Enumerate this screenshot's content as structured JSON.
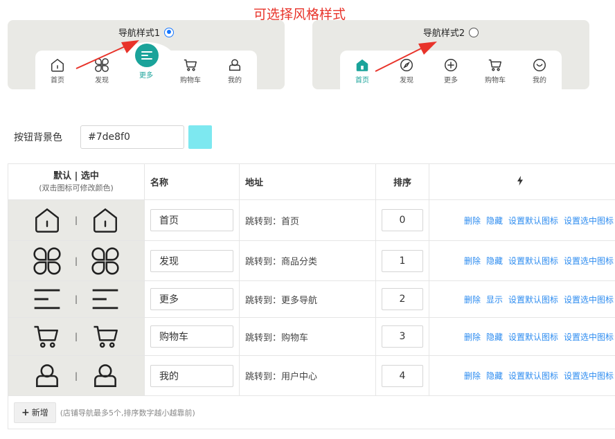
{
  "page": {
    "title": "可选择风格样式"
  },
  "styles": [
    {
      "label": "导航样式1",
      "checked": true
    },
    {
      "label": "导航样式2",
      "checked": false
    }
  ],
  "preview1": {
    "items": [
      "首页",
      "发现",
      "更多",
      "购物车",
      "我的"
    ]
  },
  "preview2": {
    "items": [
      "首页",
      "发现",
      "更多",
      "购物车",
      "我的"
    ]
  },
  "color": {
    "label": "按钮背景色",
    "value": "#7de8f0",
    "swatch": "#7de8f0"
  },
  "accent": "#1aa39a",
  "table": {
    "headers": {
      "icon_main": "默认 | 选中",
      "icon_sub": "(双击图标可修改颜色)",
      "name": "名称",
      "address": "地址",
      "sort": "排序",
      "ops_icon": "lightning-icon"
    },
    "separator": "|",
    "rows": [
      {
        "icon": "home-icon",
        "name": "首页",
        "address": "跳转到：首页",
        "sort": "0",
        "ops": [
          "删除",
          "隐藏",
          "设置默认图标",
          "设置选中图标"
        ]
      },
      {
        "icon": "clover-icon",
        "name": "发现",
        "address": "跳转到：商品分类",
        "sort": "1",
        "ops": [
          "删除",
          "隐藏",
          "设置默认图标",
          "设置选中图标"
        ]
      },
      {
        "icon": "menu-lines-icon",
        "name": "更多",
        "address": "跳转到：更多导航",
        "sort": "2",
        "ops": [
          "删除",
          "显示",
          "设置默认图标",
          "设置选中图标"
        ]
      },
      {
        "icon": "cart-icon",
        "name": "购物车",
        "address": "跳转到：购物车",
        "sort": "3",
        "ops": [
          "删除",
          "隐藏",
          "设置默认图标",
          "设置选中图标"
        ]
      },
      {
        "icon": "user-icon",
        "name": "我的",
        "address": "跳转到：用户中心",
        "sort": "4",
        "ops": [
          "删除",
          "隐藏",
          "设置默认图标",
          "设置选中图标"
        ]
      }
    ]
  },
  "footer": {
    "add_label": "新增",
    "hint": "(店铺导航最多5个,排序数字越小越靠前)"
  }
}
